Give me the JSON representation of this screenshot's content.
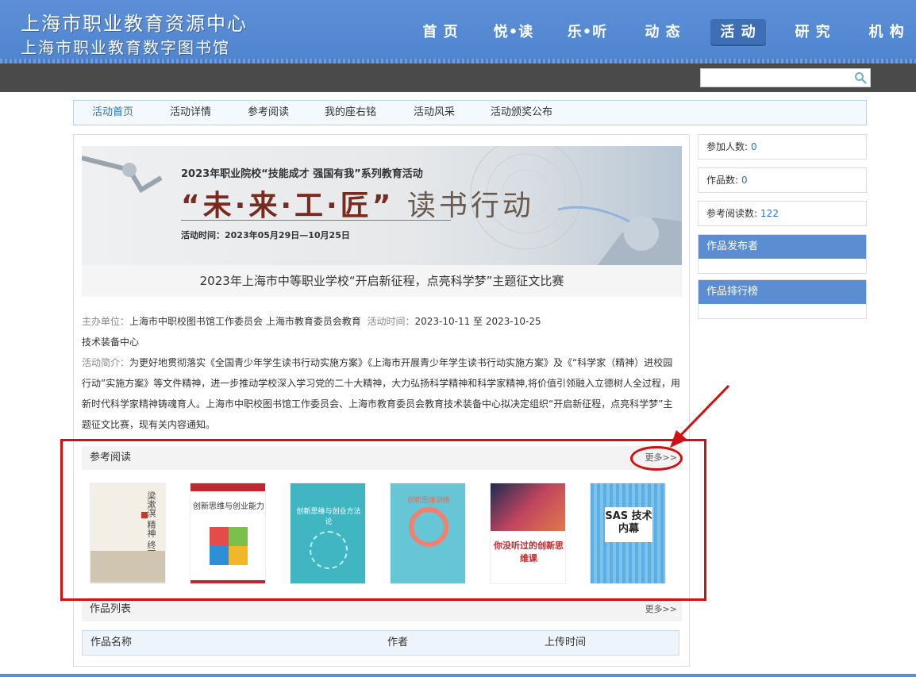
{
  "header": {
    "title_line1": "上海市职业教育资源中心",
    "title_line2": "上海市职业教育数字图书馆",
    "nav": [
      {
        "label": "首 页"
      },
      {
        "label": "悦•读"
      },
      {
        "label": "乐•听"
      },
      {
        "label": "动 态"
      },
      {
        "label": "活 动"
      },
      {
        "label": "研 究"
      },
      {
        "label": "机 构"
      }
    ],
    "active_nav": "活 动"
  },
  "search": {
    "placeholder": ""
  },
  "subnav": [
    {
      "label": "活动首页"
    },
    {
      "label": "活动详情"
    },
    {
      "label": "参考阅读"
    },
    {
      "label": "我的座右铭"
    },
    {
      "label": "活动风采"
    },
    {
      "label": "活动颁奖公布"
    }
  ],
  "banner": {
    "subtitle": "2023年职业院校“技能成才 强国有我”系列教育活动",
    "main_a": "“未·来·",
    "main_b": "工·匠” ",
    "main_c": "读书行动",
    "time": "活动时间：2023年05月29日—10月25日"
  },
  "contest": {
    "title": "2023年上海市中等职业学校“开启新征程，点亮科学梦”主题征文比赛",
    "organizer_label": "主办单位：",
    "organizer": "上海市中职校图书馆工作委员会 上海市教育委员会教育",
    "time_label": "活动时间：",
    "time": "2023-10-11 至 2023-10-25",
    "organizer_cont": "技术装备中心",
    "intro_label": "活动简介：",
    "intro": "为更好地贯彻落实《全国青少年学生读书行动实施方案》《上海市开展青少年学生读书行动实施方案》及《“科学家（精神）进校园行动”实施方案》等文件精神，进一步推动学校深入学习党的二十大精神，大力弘扬科学精神和科学家精神,将价值引领融入立德树人全过程，用新时代科学家精神铸魂育人。上海市中职校图书馆工作委员会、上海市教育委员会教育技术装备中心拟决定组织“开启新征程，点亮科学梦”主题征文比赛，现有关内容通知。"
  },
  "reading": {
    "title": "参考阅读",
    "more": "更多>>",
    "books": [
      {
        "cover_text": "梁漱溟 精神 终不改",
        "color": "#f3efe6"
      },
      {
        "cover_text": "创新思维与创业能力",
        "color": "#ffffff"
      },
      {
        "cover_text": "创新思维与创业方法论",
        "color": "#3fb6c2"
      },
      {
        "cover_text": "创新思维训练",
        "color": "#66c6d6"
      },
      {
        "cover_text": "你没听过的创新思维课",
        "color": "#2c3e6a"
      },
      {
        "cover_text": "SAS 技术内幕",
        "color": "#5aaee0"
      }
    ]
  },
  "works": {
    "title": "作品列表",
    "more": "更多>>",
    "columns": [
      "作品名称",
      "作者",
      "上传时间"
    ]
  },
  "sidebar": {
    "stats": [
      {
        "label": "参加人数:",
        "value": "0"
      },
      {
        "label": "作品数:",
        "value": "0"
      },
      {
        "label": "参考阅读数:",
        "value": "122"
      }
    ],
    "boxes": [
      {
        "title": "作品发布者"
      },
      {
        "title": "作品排行榜"
      }
    ]
  },
  "colors": {
    "header_blue": "#5b8dd3",
    "link_blue": "#2b73c4",
    "annotation_red": "#d40f0f"
  }
}
